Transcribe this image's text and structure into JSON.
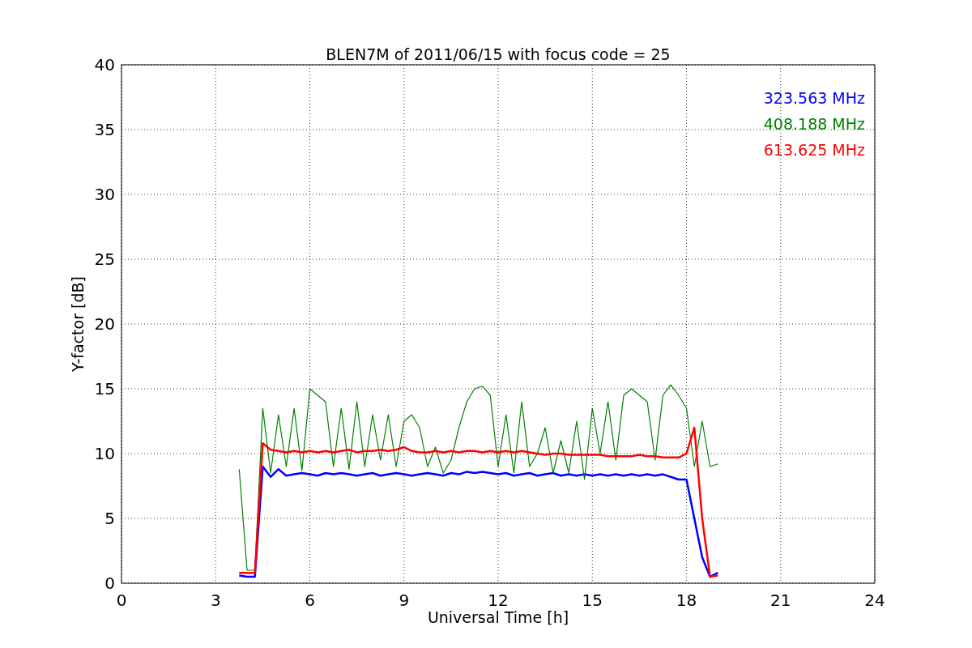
{
  "chart_data": {
    "type": "line",
    "grid": true,
    "title": "BLEN7M of 2011/06/15 with focus code = 25",
    "xlabel": "Universal Time [h]",
    "ylabel": "Y-factor [dB]",
    "xlim": [
      0,
      24
    ],
    "ylim": [
      0,
      40
    ],
    "xticks": [
      0,
      3,
      6,
      9,
      12,
      15,
      18,
      21,
      24
    ],
    "yticks": [
      0,
      5,
      10,
      15,
      20,
      25,
      30,
      35,
      40
    ],
    "x": [
      3.75,
      4,
      4.25,
      4.5,
      4.75,
      5,
      5.25,
      5.5,
      5.75,
      6,
      6.25,
      6.5,
      6.75,
      7,
      7.25,
      7.5,
      7.75,
      8,
      8.25,
      8.5,
      8.75,
      9,
      9.25,
      9.5,
      9.75,
      10,
      10.25,
      10.5,
      10.75,
      11,
      11.25,
      11.5,
      11.75,
      12,
      12.25,
      12.5,
      12.75,
      13,
      13.25,
      13.5,
      13.75,
      14,
      14.25,
      14.5,
      14.75,
      15,
      15.25,
      15.5,
      15.75,
      16,
      16.25,
      16.5,
      16.75,
      17,
      17.25,
      17.5,
      17.75,
      18,
      18.25,
      18.5,
      18.75,
      19
    ],
    "series": [
      {
        "name": "323.563 MHz",
        "color": "#0000ff",
        "values": [
          0.6,
          0.5,
          0.5,
          9.0,
          8.2,
          8.8,
          8.3,
          8.4,
          8.5,
          8.4,
          8.3,
          8.5,
          8.4,
          8.5,
          8.4,
          8.3,
          8.4,
          8.5,
          8.3,
          8.4,
          8.5,
          8.4,
          8.3,
          8.4,
          8.5,
          8.4,
          8.3,
          8.5,
          8.4,
          8.6,
          8.5,
          8.6,
          8.5,
          8.4,
          8.5,
          8.3,
          8.4,
          8.5,
          8.3,
          8.4,
          8.5,
          8.3,
          8.4,
          8.3,
          8.4,
          8.3,
          8.4,
          8.3,
          8.4,
          8.3,
          8.4,
          8.3,
          8.4,
          8.3,
          8.4,
          8.2,
          8.0,
          8.0,
          5.0,
          2.0,
          0.5,
          0.8
        ]
      },
      {
        "name": "408.188 MHz",
        "color": "#008000",
        "values": [
          8.8,
          1.0,
          1.0,
          13.5,
          8.5,
          13.0,
          9.0,
          13.5,
          8.7,
          15.0,
          14.5,
          14.0,
          9.0,
          13.5,
          8.8,
          14.0,
          9.0,
          13.0,
          9.5,
          13.0,
          9.0,
          12.5,
          13.0,
          12.0,
          9.0,
          10.5,
          8.5,
          9.5,
          12.0,
          14.0,
          15.0,
          15.2,
          14.5,
          9.0,
          13.0,
          8.5,
          14.0,
          9.0,
          10.0,
          12.0,
          8.5,
          11.0,
          8.5,
          12.5,
          8.0,
          13.5,
          10.0,
          14.0,
          9.5,
          14.5,
          15.0,
          14.5,
          14.0,
          9.5,
          14.5,
          15.3,
          14.5,
          13.5,
          9.0,
          12.5,
          9.0,
          9.2
        ]
      },
      {
        "name": "613.625 MHz",
        "color": "#ff0000",
        "values": [
          0.8,
          0.8,
          0.8,
          10.8,
          10.3,
          10.2,
          10.1,
          10.2,
          10.1,
          10.2,
          10.1,
          10.2,
          10.1,
          10.2,
          10.3,
          10.1,
          10.2,
          10.2,
          10.3,
          10.2,
          10.3,
          10.5,
          10.2,
          10.1,
          10.1,
          10.2,
          10.1,
          10.2,
          10.1,
          10.2,
          10.2,
          10.1,
          10.2,
          10.1,
          10.2,
          10.1,
          10.2,
          10.1,
          10.0,
          9.9,
          10.0,
          10.0,
          9.9,
          9.9,
          9.9,
          9.9,
          9.9,
          9.8,
          9.8,
          9.8,
          9.8,
          9.9,
          9.8,
          9.8,
          9.7,
          9.7,
          9.7,
          10.0,
          12.0,
          5.0,
          0.5,
          0.6
        ]
      }
    ]
  }
}
